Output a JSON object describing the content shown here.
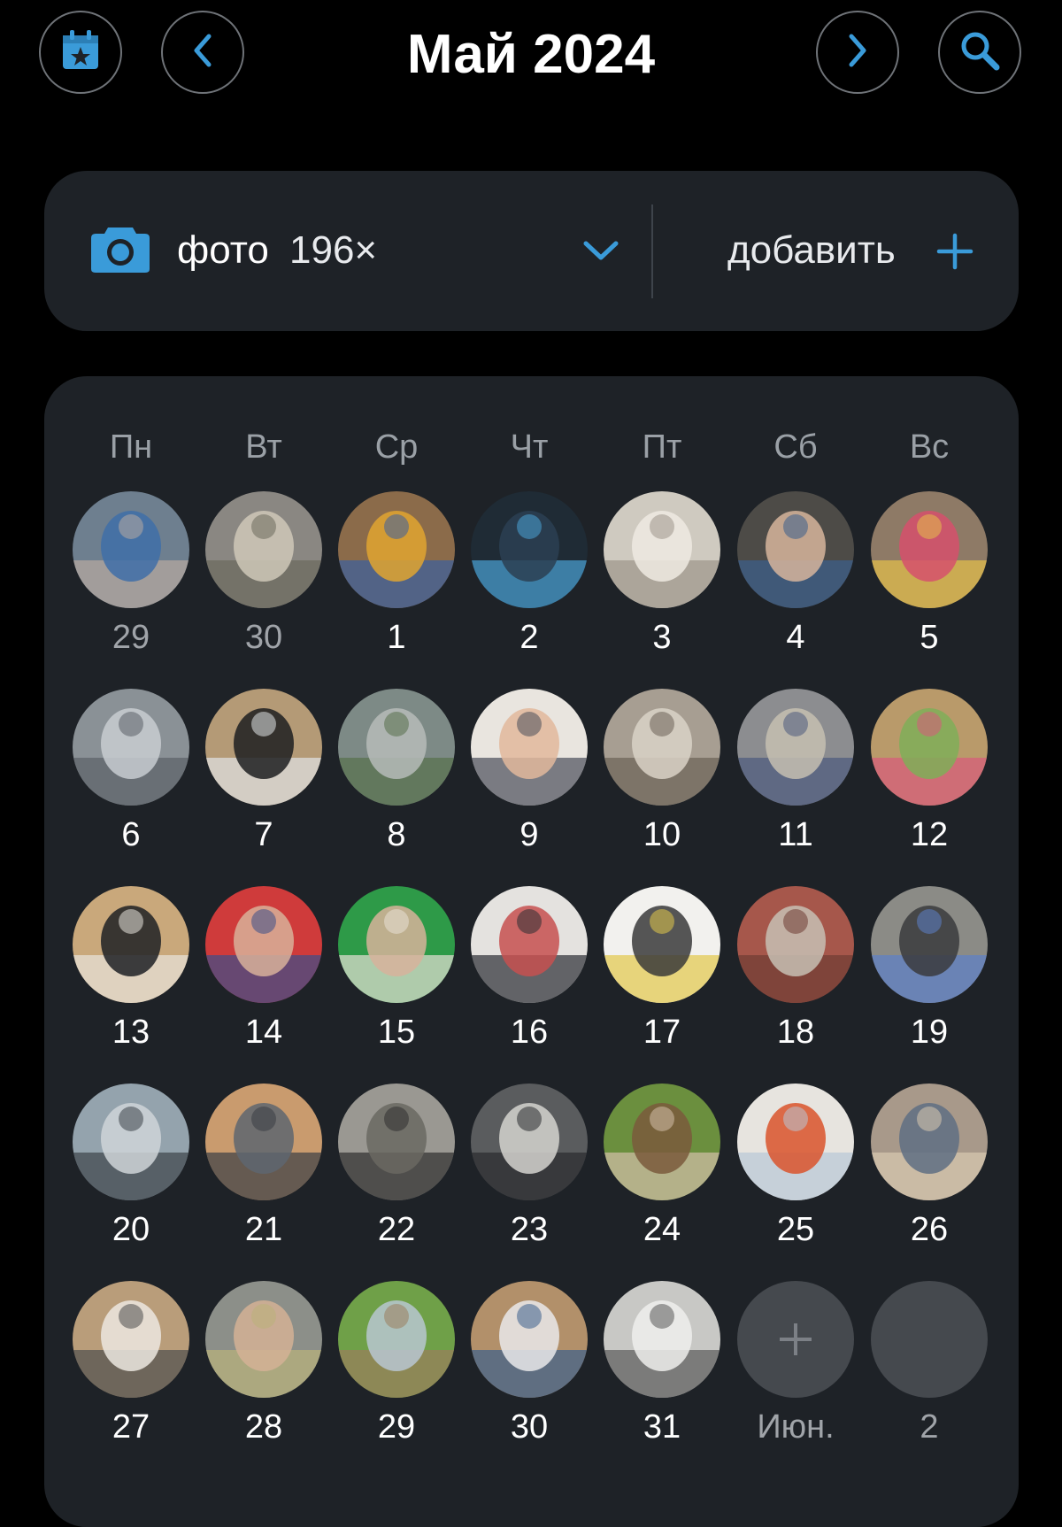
{
  "header": {
    "title": "Май 2024",
    "calendar_button": {
      "icon": "calendar-star-icon"
    },
    "prev_button": {
      "icon": "chevron-left-icon"
    },
    "next_button": {
      "icon": "chevron-right-icon"
    },
    "search_button": {
      "icon": "search-icon"
    }
  },
  "media": {
    "icon": "camera-icon",
    "label": "фото",
    "count": "196×",
    "dropdown_icon": "chevron-down-icon",
    "add_label": "добавить",
    "add_icon": "plus-icon"
  },
  "colors": {
    "accent": "#3a9bd9",
    "card_bg": "#1e2227",
    "page_bg": "#000000",
    "muted_text": "#a0a4a9",
    "placeholder": "#45494e"
  },
  "calendar": {
    "weekdays": [
      "Пн",
      "Вт",
      "Ср",
      "Чт",
      "Пт",
      "Сб",
      "Вс"
    ],
    "weeks": [
      [
        {
          "label": "29",
          "muted": true,
          "thumb": "playground-swing"
        },
        {
          "label": "30",
          "muted": true,
          "thumb": "child-on-floor"
        },
        {
          "label": "1",
          "thumb": "child-yellow-jacket"
        },
        {
          "label": "2",
          "thumb": "zero-h2o-bottle"
        },
        {
          "label": "3",
          "thumb": "white-grains-tray"
        },
        {
          "label": "4",
          "thumb": "man-in-car"
        },
        {
          "label": "5",
          "thumb": "child-sunglasses"
        }
      ],
      [
        {
          "label": "6",
          "thumb": "steel-structure"
        },
        {
          "label": "7",
          "thumb": "black-device"
        },
        {
          "label": "8",
          "thumb": "city-sidewalk"
        },
        {
          "label": "9",
          "thumb": "baby-portrait"
        },
        {
          "label": "10",
          "thumb": "mall-hall"
        },
        {
          "label": "11",
          "thumb": "warehouse"
        },
        {
          "label": "12",
          "thumb": "child-sandbox"
        }
      ],
      [
        {
          "label": "13",
          "thumb": "device-box"
        },
        {
          "label": "14",
          "thumb": "couple-selfie"
        },
        {
          "label": "15",
          "thumb": "family-green"
        },
        {
          "label": "16",
          "thumb": "father-child"
        },
        {
          "label": "17",
          "thumb": "coloring-page"
        },
        {
          "label": "18",
          "thumb": "brick-wall"
        },
        {
          "label": "19",
          "thumb": "child-shadow"
        }
      ],
      [
        {
          "label": "20",
          "thumb": "bridge-railing"
        },
        {
          "label": "21",
          "thumb": "road-sunset"
        },
        {
          "label": "22",
          "thumb": "pavement-bike"
        },
        {
          "label": "23",
          "thumb": "car-interior"
        },
        {
          "label": "24",
          "thumb": "bench-garden"
        },
        {
          "label": "25",
          "thumb": "orange-sofa"
        },
        {
          "label": "26",
          "thumb": "museum-family"
        }
      ],
      [
        {
          "label": "27",
          "thumb": "paper-sheet"
        },
        {
          "label": "28",
          "thumb": "card-in-hand"
        },
        {
          "label": "29",
          "thumb": "park-green"
        },
        {
          "label": "30",
          "thumb": "sealed-package"
        },
        {
          "label": "31",
          "thumb": "document-notice"
        },
        {
          "label": "Июн.",
          "muted": true,
          "placeholder": true,
          "plus": true
        },
        {
          "label": "2",
          "muted": true,
          "placeholder": true
        }
      ]
    ]
  }
}
